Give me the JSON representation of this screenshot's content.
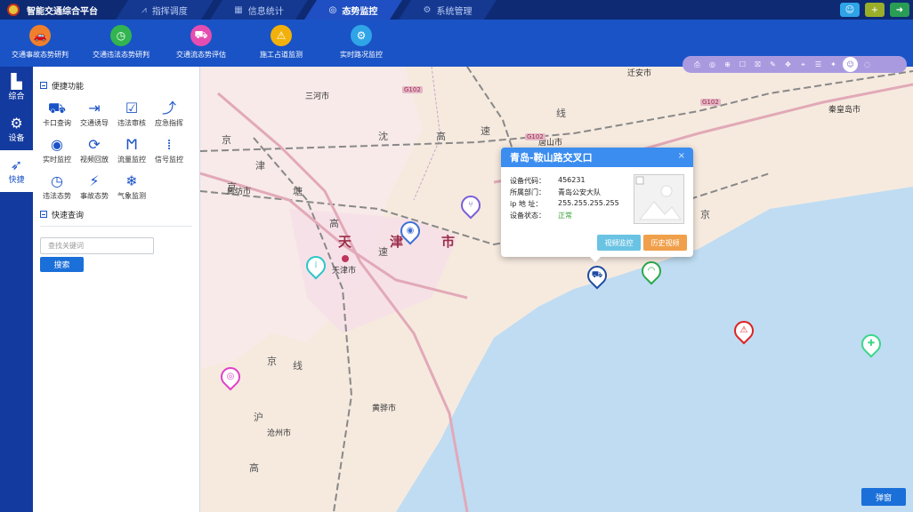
{
  "app": {
    "title": "智能交通综合平台"
  },
  "nav": [
    {
      "label": "指挥调度",
      "icon": "flow-icon",
      "glyph": "⩘"
    },
    {
      "label": "信息统计",
      "icon": "chart-icon",
      "glyph": "▦"
    },
    {
      "label": "态势监控",
      "icon": "monitor-icon",
      "glyph": "◎",
      "active": true
    },
    {
      "label": "系统管理",
      "icon": "gear-icon",
      "glyph": "⚙"
    }
  ],
  "top_actions": [
    {
      "icon": "user-icon",
      "glyph": "☺",
      "color": "#2fa4e7"
    },
    {
      "icon": "add-icon",
      "glyph": "+",
      "color": "#9aae2a"
    },
    {
      "icon": "logout-icon",
      "glyph": "➜",
      "color": "#2a9d55"
    }
  ],
  "modules": [
    {
      "label": "交通事故态势研判",
      "color": "#f07f2c",
      "glyph": "🚗"
    },
    {
      "label": "交通违法态势研判",
      "color": "#32b450",
      "glyph": "◷"
    },
    {
      "label": "交通流态势评估",
      "color": "#e64db0",
      "glyph": "⛟"
    },
    {
      "label": "施工占道监测",
      "color": "#f2b10a",
      "glyph": "⚠"
    },
    {
      "label": "实时路况监控",
      "color": "#2fa4e7",
      "glyph": "⚙"
    }
  ],
  "vtabs": [
    {
      "label": "综合",
      "glyph": "▙"
    },
    {
      "label": "设备",
      "glyph": "⚙"
    },
    {
      "label": "快捷",
      "glyph": "➶",
      "active": true
    }
  ],
  "shortcuts": {
    "title": "便捷功能",
    "items": [
      {
        "label": "卡口查询",
        "glyph": "⛟"
      },
      {
        "label": "交通诱导",
        "glyph": "⇥"
      },
      {
        "label": "违法审核",
        "glyph": "☑"
      },
      {
        "label": "应急指挥",
        "glyph": "⤴"
      },
      {
        "label": "实时监控",
        "glyph": "◉"
      },
      {
        "label": "视频回放",
        "glyph": "⟳"
      },
      {
        "label": "流量监控",
        "glyph": "Ϻ"
      },
      {
        "label": "信号监控",
        "glyph": "⁞"
      },
      {
        "label": "违法态势",
        "glyph": "◷"
      },
      {
        "label": "事故态势",
        "glyph": "⚡"
      },
      {
        "label": "气象监测",
        "glyph": "❄"
      }
    ]
  },
  "quick_search": {
    "title": "快速查询",
    "placeholder": "查找关键词",
    "button": "搜索"
  },
  "map": {
    "labels": [
      {
        "text": "三河市"
      },
      {
        "text": "廊坊市"
      },
      {
        "text": "天津市"
      },
      {
        "text": "唐山市"
      },
      {
        "text": "迁安市"
      },
      {
        "text": "秦皇岛市"
      },
      {
        "text": "沧州市"
      },
      {
        "text": "黄骅市"
      }
    ],
    "big": [
      "天",
      "津",
      "市"
    ],
    "roads": [
      "京",
      "沈",
      "高",
      "速",
      "线",
      "京",
      "津",
      "塘",
      "速",
      "高",
      "京",
      "线",
      "沪",
      "高",
      "京"
    ],
    "shields": [
      "G102",
      "G102",
      "G102"
    ]
  },
  "map_tools": [
    "⎙",
    "◎",
    "⊕",
    "☐",
    "⛝",
    "✎",
    "✥",
    "⌖",
    "☰",
    "✦",
    "☺",
    "◌"
  ],
  "popup": {
    "title": "青岛-鞍山路交叉口",
    "rows": [
      {
        "k": "设备代码：",
        "v": "456231"
      },
      {
        "k": "所属部门：",
        "v": "青岛公安大队"
      },
      {
        "k": "ip  地  址：",
        "v": "255.255.255.255"
      },
      {
        "k": "设备状态：",
        "v": "正常",
        "ok": true
      }
    ],
    "btn_video": "视频监控",
    "btn_history": "历史视频",
    "close": "×"
  },
  "popwin_button": "弹窗",
  "colors": {
    "nav_bg": "#0d2a73",
    "toolbar_bg": "#1a53c6",
    "accent": "#3b8df0"
  }
}
